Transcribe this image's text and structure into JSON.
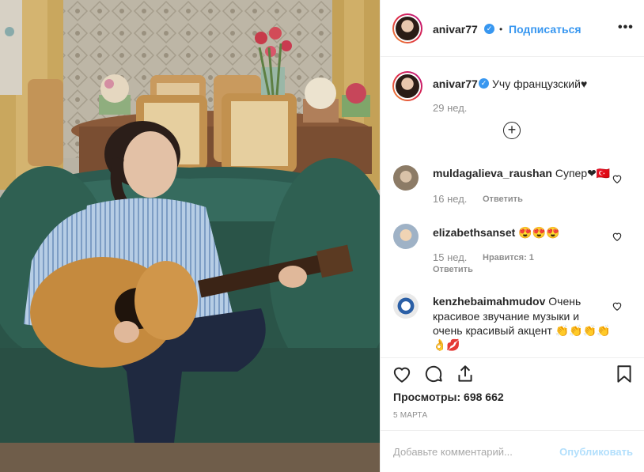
{
  "post": {
    "author": "anivar77",
    "follow_label": "Подписаться",
    "more_label": "•••",
    "separator": "•"
  },
  "caption": {
    "username": "anivar77",
    "text": "Учу французский♥",
    "time": "29 нед."
  },
  "comments": [
    {
      "username": "muldagalieva_raushan",
      "text": "Супер❤🇹🇷",
      "time": "16 нед.",
      "reply_label": "Ответить",
      "likes_label": ""
    },
    {
      "username": "elizabethsanset",
      "text": "😍😍😍",
      "time": "15 нед.",
      "likes_label": "Нравится: 1",
      "reply_label": "Ответить"
    },
    {
      "username": "kenzhebaimahmudov",
      "text_line1": "Очень",
      "text_line2": "красивое звучание музыки и",
      "text_line3": "очень красивый акцент 👏👏👏👏",
      "text_line4": "👌💋"
    }
  ],
  "stats": {
    "views_label": "Просмотры: 698 662",
    "date": "5 МАРТА"
  },
  "composer": {
    "placeholder": "Добавьте комментарий...",
    "publish_label": "Опубликовать"
  },
  "colors": {
    "accent": "#3897f0",
    "muted": "#8e8e8e",
    "publish_disabled": "#b2dffc",
    "sofa": "#2e5a4f"
  },
  "icons": [
    "verified-icon",
    "plus-circle-icon",
    "heart-icon",
    "comment-icon",
    "share-icon",
    "bookmark-icon"
  ]
}
